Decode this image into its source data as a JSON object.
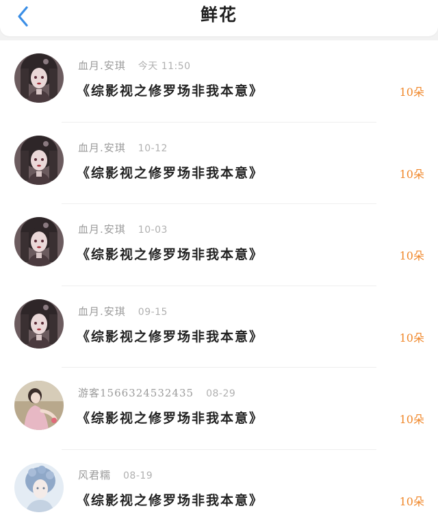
{
  "header": {
    "title": "鲜花",
    "back_icon": "chevron-left-icon",
    "accent_color": "#3a8ee6"
  },
  "colors": {
    "count": "#f0872a",
    "username": "#9a9a9a"
  },
  "items": [
    {
      "user": "血月.安琪",
      "date": "今天 11:50",
      "book": "《综影视之修罗场非我本意》",
      "count": "10朵",
      "avatar": "gothic-girl-avatar"
    },
    {
      "user": "血月.安琪",
      "date": "10-12",
      "book": "《综影视之修罗场非我本意》",
      "count": "10朵",
      "avatar": "gothic-girl-avatar"
    },
    {
      "user": "血月.安琪",
      "date": "10-03",
      "book": "《综影视之修罗场非我本意》",
      "count": "10朵",
      "avatar": "gothic-girl-avatar"
    },
    {
      "user": "血月.安琪",
      "date": "09-15",
      "book": "《综影视之修罗场非我本意》",
      "count": "10朵",
      "avatar": "gothic-girl-avatar"
    },
    {
      "user": "游客1566324532435",
      "date": "08-29",
      "book": "《综影视之修罗场非我本意》",
      "count": "10朵",
      "avatar": "pink-dress-girl-avatar"
    },
    {
      "user": "风君糯",
      "date": "08-19",
      "book": "《综影视之修罗场非我本意》",
      "count": "10朵",
      "avatar": "blue-hair-girl-avatar"
    }
  ]
}
